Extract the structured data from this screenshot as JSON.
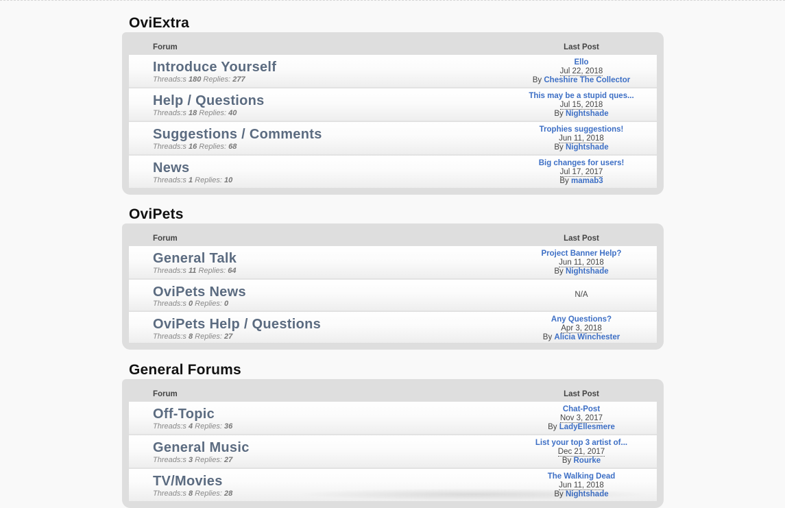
{
  "header": {
    "forum_label": "Forum",
    "last_post_label": "Last Post"
  },
  "stats_labels": {
    "threads": "Threads:s",
    "replies": "Replies:"
  },
  "by_label": "By",
  "categories": [
    {
      "title": "OviExtra",
      "forums": [
        {
          "name": "Introduce Yourself",
          "threads": "180",
          "replies": "277",
          "last_post": {
            "title": "Ello",
            "date": "Jul 22, 2018",
            "user": "Cheshire The Collector"
          }
        },
        {
          "name": "Help / Questions",
          "threads": "18",
          "replies": "40",
          "last_post": {
            "title": "This may be a stupid ques...",
            "date": "Jul 15, 2018",
            "user": "Nightshade"
          }
        },
        {
          "name": "Suggestions / Comments",
          "threads": "16",
          "replies": "68",
          "last_post": {
            "title": "Trophies suggestions!",
            "date": "Jun 11, 2018",
            "user": "Nightshade"
          }
        },
        {
          "name": "News",
          "threads": "1",
          "replies": "10",
          "last_post": {
            "title": "Big changes for users!",
            "date": "Jul 17, 2017",
            "user": "mamab3"
          }
        }
      ]
    },
    {
      "title": "OviPets",
      "forums": [
        {
          "name": "General Talk",
          "threads": "11",
          "replies": "64",
          "last_post": {
            "title": "Project Banner Help?",
            "date": "Jun 11, 2018",
            "user": "Nightshade"
          }
        },
        {
          "name": "OviPets News",
          "threads": "0",
          "replies": "0",
          "last_post": null,
          "na_text": "N/A"
        },
        {
          "name": "OviPets Help / Questions",
          "threads": "8",
          "replies": "27",
          "last_post": {
            "title": "Any Questions?",
            "date": "Apr 3, 2018",
            "user": "Alicia Winchester"
          }
        }
      ]
    },
    {
      "title": "General Forums",
      "forums": [
        {
          "name": "Off-Topic",
          "threads": "4",
          "replies": "36",
          "last_post": {
            "title": "Chat-Post",
            "date": "Nov 3, 2017",
            "user": "LadyEllesmere"
          }
        },
        {
          "name": "General Music",
          "threads": "3",
          "replies": "27",
          "last_post": {
            "title": "List your top 3 artist of...",
            "date": "Dec 21, 2017",
            "user": "Rourke"
          }
        },
        {
          "name": "TV/Movies",
          "threads": "8",
          "replies": "28",
          "last_post": {
            "title": "The Walking Dead",
            "date": "Jun 11, 2018",
            "user": "Nightshade"
          }
        }
      ]
    }
  ],
  "colors": {
    "forum_name": "#5b6b80",
    "link": "#3d6fc5",
    "panel": "#dedede",
    "page_bg": "#f9f9f9"
  }
}
